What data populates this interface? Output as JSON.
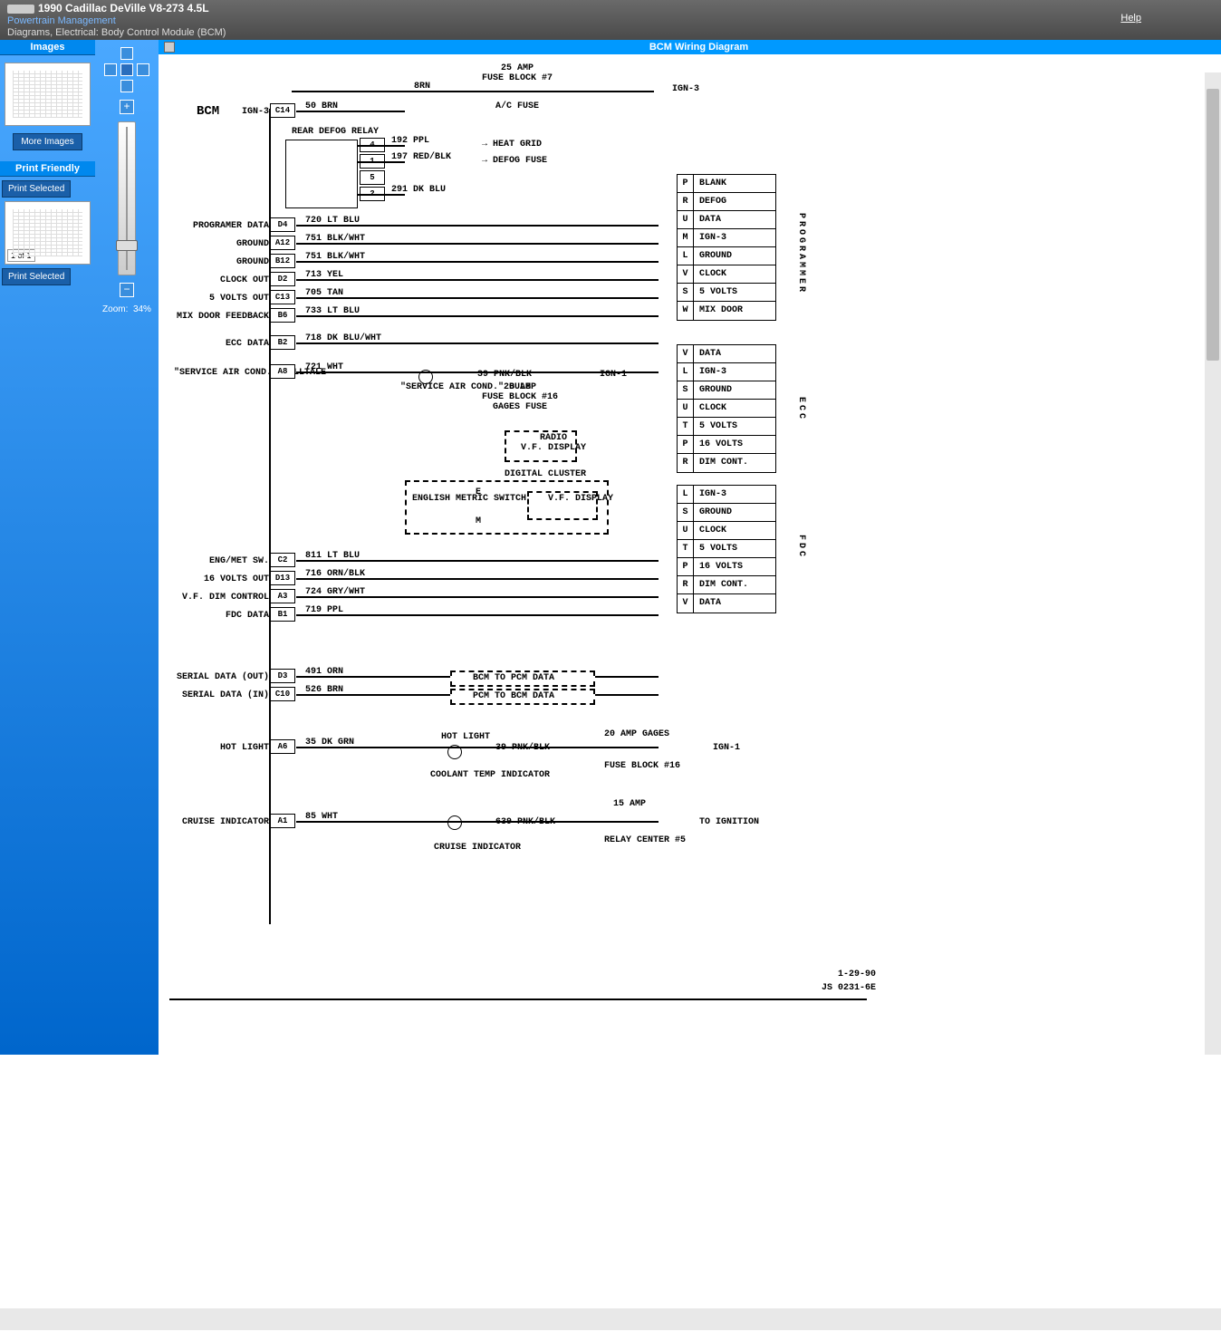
{
  "header": {
    "title": "1990 Cadillac DeVille V8-273 4.5L",
    "subtitle1": "Powertrain Management",
    "subtitle2": "Diagrams, Electrical: Body Control Module (BCM)",
    "help": "Help"
  },
  "sidebar": {
    "images_header": "Images",
    "more_images": "More Images",
    "print_header": "Print Friendly",
    "print_selected": "Print Selected",
    "page_indicator": "1 of 1"
  },
  "zoom": {
    "label": "Zoom:",
    "value": "34%",
    "plus": "+",
    "minus": "−"
  },
  "viewer": {
    "title": "BCM Wiring Diagram"
  },
  "diagram": {
    "title": "BCM",
    "top_fuse": "25 AMP\nFUSE BLOCK #7",
    "ac_fuse": "A/C FUSE",
    "rear_defog": "REAR DEFOG RELAY",
    "date": "1-29-90",
    "code": "JS 0231-6E",
    "bcm_pins": [
      {
        "label": "IGN-3",
        "pin": "C14",
        "wire": "50 BRN"
      },
      {
        "label": "",
        "pin": "4",
        "wire": "192 PPL",
        "dest": "HEAT GRID"
      },
      {
        "label": "",
        "pin": "1",
        "wire": "197 RED/BLK",
        "dest": "DEFOG FUSE"
      },
      {
        "label": "",
        "pin": "5",
        "wire": ""
      },
      {
        "label": "",
        "pin": "2",
        "wire": "291 DK BLU"
      },
      {
        "label": "PROGRAMER DATA",
        "pin": "D4",
        "wire": "720 LT BLU"
      },
      {
        "label": "GROUND",
        "pin": "A12",
        "wire": "751 BLK/WHT"
      },
      {
        "label": "GROUND",
        "pin": "B12",
        "wire": "751 BLK/WHT"
      },
      {
        "label": "CLOCK OUT",
        "pin": "D2",
        "wire": "713 YEL"
      },
      {
        "label": "5 VOLTS OUT",
        "pin": "C13",
        "wire": "705 TAN"
      },
      {
        "label": "MIX DOOR FEEDBACK",
        "pin": "B6",
        "wire": "733 LT BLU"
      },
      {
        "label": "ECC DATA",
        "pin": "B2",
        "wire": "718 DK BLU/WHT"
      },
      {
        "label": "\"SERVICE AIR COND.\" TELLTALE",
        "pin": "A8",
        "wire": "721 WHT"
      },
      {
        "label": "ENG/MET SW.",
        "pin": "C2",
        "wire": "811 LT BLU"
      },
      {
        "label": "16 VOLTS OUT",
        "pin": "D13",
        "wire": "716 ORN/BLK"
      },
      {
        "label": "V.F. DIM CONTROL",
        "pin": "A3",
        "wire": "724 GRY/WHT"
      },
      {
        "label": "FDC DATA",
        "pin": "B1",
        "wire": "719 PPL"
      },
      {
        "label": "SERIAL DATA (OUT)",
        "pin": "D3",
        "wire": "491 ORN"
      },
      {
        "label": "SERIAL DATA (IN)",
        "pin": "C10",
        "wire": "526 BRN"
      },
      {
        "label": "HOT LIGHT",
        "pin": "A6",
        "wire": "35 DK GRN"
      },
      {
        "label": "CRUISE INDICATOR",
        "pin": "A1",
        "wire": "85 WHT"
      }
    ],
    "top_wire": "8RN",
    "ign3": "IGN-3",
    "ign1": "IGN-1",
    "service_bulb": "\"SERVICE AIR COND.\" BULB",
    "fuse16": "20 AMP\nFUSE BLOCK #16\nGAGES FUSE",
    "wire39": "39 PNK/BLK",
    "radio_vf": "RADIO\nV.F. DISPLAY",
    "digital_cluster": "DIGITAL CLUSTER",
    "english_metric": "ENGLISH METRIC SWITCH",
    "em_e": "E",
    "em_m": "M",
    "vf_display": "V.F. DISPLAY",
    "bcm_pcm": "BCM TO PCM DATA",
    "pcm_bcm": "PCM TO BCM DATA",
    "hot_light_lbl": "HOT LIGHT",
    "coolant": "COOLANT TEMP INDICATOR",
    "gages20": "20 AMP GAGES",
    "fuse16b": "FUSE BLOCK #16",
    "cruise_ind": "CRUISE INDICATOR",
    "amp15": "15 AMP",
    "to_ignition": "TO IGNITION",
    "relay5": "RELAY CENTER #5",
    "wire639": "639 PNK/BLK",
    "programmer_label": "PROGRAMMER",
    "ecc_label": "ECC",
    "fdc_label": "FDC",
    "conn_programmer": [
      {
        "pin": "P",
        "label": "BLANK"
      },
      {
        "pin": "R",
        "label": "DEFOG"
      },
      {
        "pin": "U",
        "label": "DATA"
      },
      {
        "pin": "M",
        "label": "IGN-3"
      },
      {
        "pin": "L",
        "label": "GROUND"
      },
      {
        "pin": "V",
        "label": "CLOCK"
      },
      {
        "pin": "S",
        "label": "5 VOLTS"
      },
      {
        "pin": "W",
        "label": "MIX DOOR"
      }
    ],
    "conn_ecc": [
      {
        "pin": "V",
        "label": "DATA"
      },
      {
        "pin": "L",
        "label": "IGN-3"
      },
      {
        "pin": "S",
        "label": "GROUND"
      },
      {
        "pin": "U",
        "label": "CLOCK"
      },
      {
        "pin": "T",
        "label": "5 VOLTS"
      },
      {
        "pin": "P",
        "label": "16 VOLTS"
      },
      {
        "pin": "R",
        "label": "DIM CONT."
      }
    ],
    "conn_fdc": [
      {
        "pin": "L",
        "label": "IGN-3"
      },
      {
        "pin": "S",
        "label": "GROUND"
      },
      {
        "pin": "U",
        "label": "CLOCK"
      },
      {
        "pin": "T",
        "label": "5 VOLTS"
      },
      {
        "pin": "P",
        "label": "16 VOLTS"
      },
      {
        "pin": "R",
        "label": "DIM CONT."
      },
      {
        "pin": "V",
        "label": "DATA"
      }
    ]
  }
}
